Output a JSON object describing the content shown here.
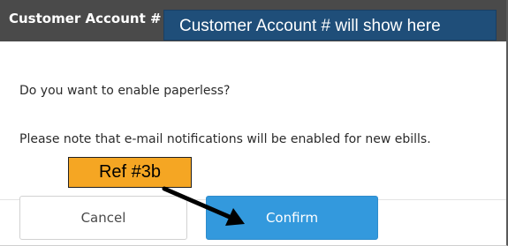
{
  "header": {
    "title": "Customer Account #",
    "background": "#4a4a4a"
  },
  "annotation": {
    "account_placeholder": "Customer Account # will show here",
    "ref_label": "Ref #3b",
    "ref_color": "#f5a623",
    "box_color": "#1f4e79"
  },
  "body": {
    "question": "Do you want to enable paperless?",
    "note": "Please note that e-mail notifications will be enabled for new ebills."
  },
  "buttons": {
    "cancel_label": "Cancel",
    "confirm_label": "Confirm",
    "confirm_color": "#3399dd"
  }
}
